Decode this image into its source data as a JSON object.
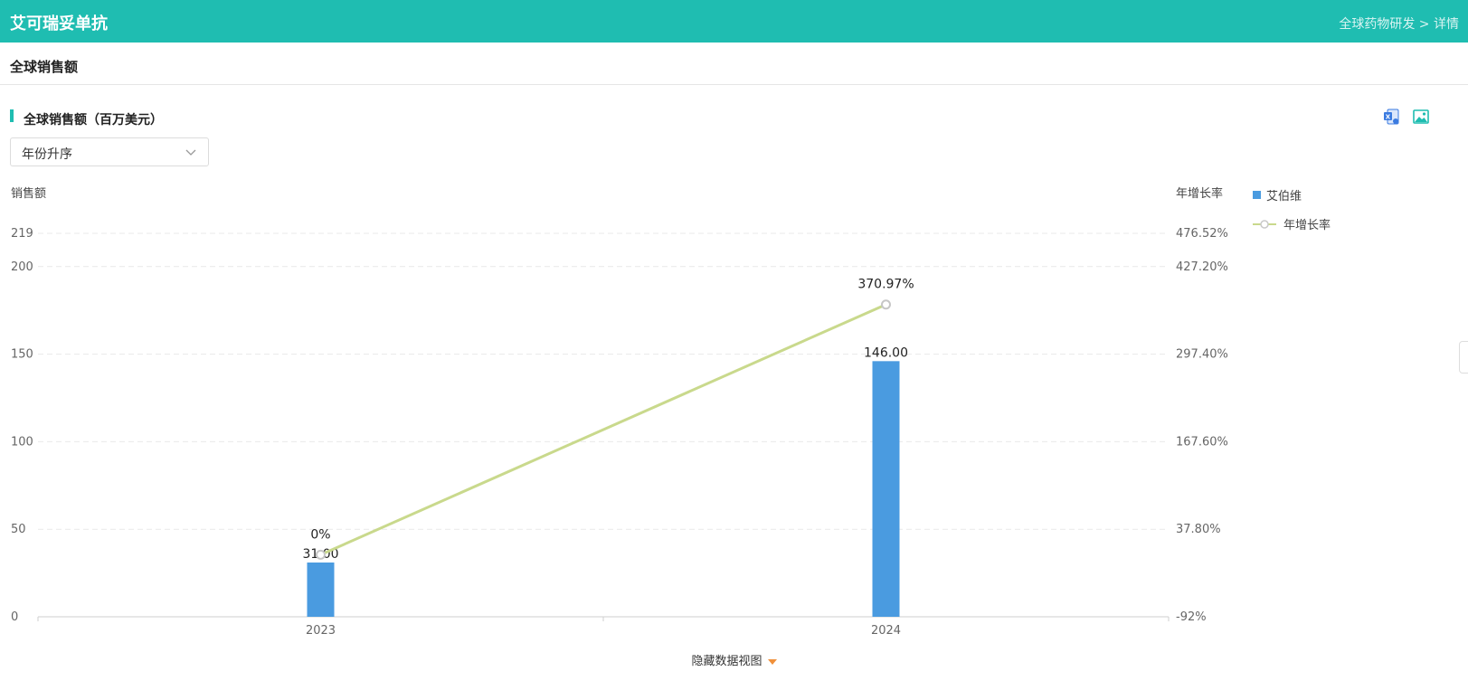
{
  "header": {
    "title": "艾可瑞妥单抗",
    "breadcrumb": {
      "parent": "全球药物研发",
      "separator": " > ",
      "current": "详情"
    }
  },
  "subheader": {
    "title": "全球销售额"
  },
  "card": {
    "title": "全球销售额（百万美元）",
    "sort_select": {
      "value": "年份升序"
    },
    "tools": {
      "excel_icon": "excel-export-icon",
      "image_icon": "image-export-icon"
    }
  },
  "footer": {
    "toggle_label": "隐藏数据视图"
  },
  "colors": {
    "accent": "#1fbdb1",
    "bar": "#4a9be0",
    "line": "#c9d98c"
  },
  "chart_data": {
    "type": "bar",
    "categories": [
      "2023",
      "2024"
    ],
    "series": [
      {
        "name": "艾伯维",
        "type": "bar",
        "axis": "left",
        "values": [
          31.0,
          146.0
        ],
        "labels": [
          "31.00",
          "146.00"
        ]
      },
      {
        "name": "年增长率",
        "type": "line",
        "axis": "right",
        "values": [
          0,
          370.97
        ],
        "labels": [
          "0%",
          "370.97%"
        ]
      }
    ],
    "ylabel": "销售额",
    "y2label": "年增长率",
    "ylim": [
      0,
      219
    ],
    "y2lim": [
      -92,
      476.52
    ],
    "yticks": [
      0,
      50,
      100,
      150,
      200,
      219
    ],
    "y2ticks": [
      "-92%",
      "37.80%",
      "167.60%",
      "297.40%",
      "427.20%",
      "476.52%"
    ],
    "grid": true,
    "legend": "right"
  }
}
